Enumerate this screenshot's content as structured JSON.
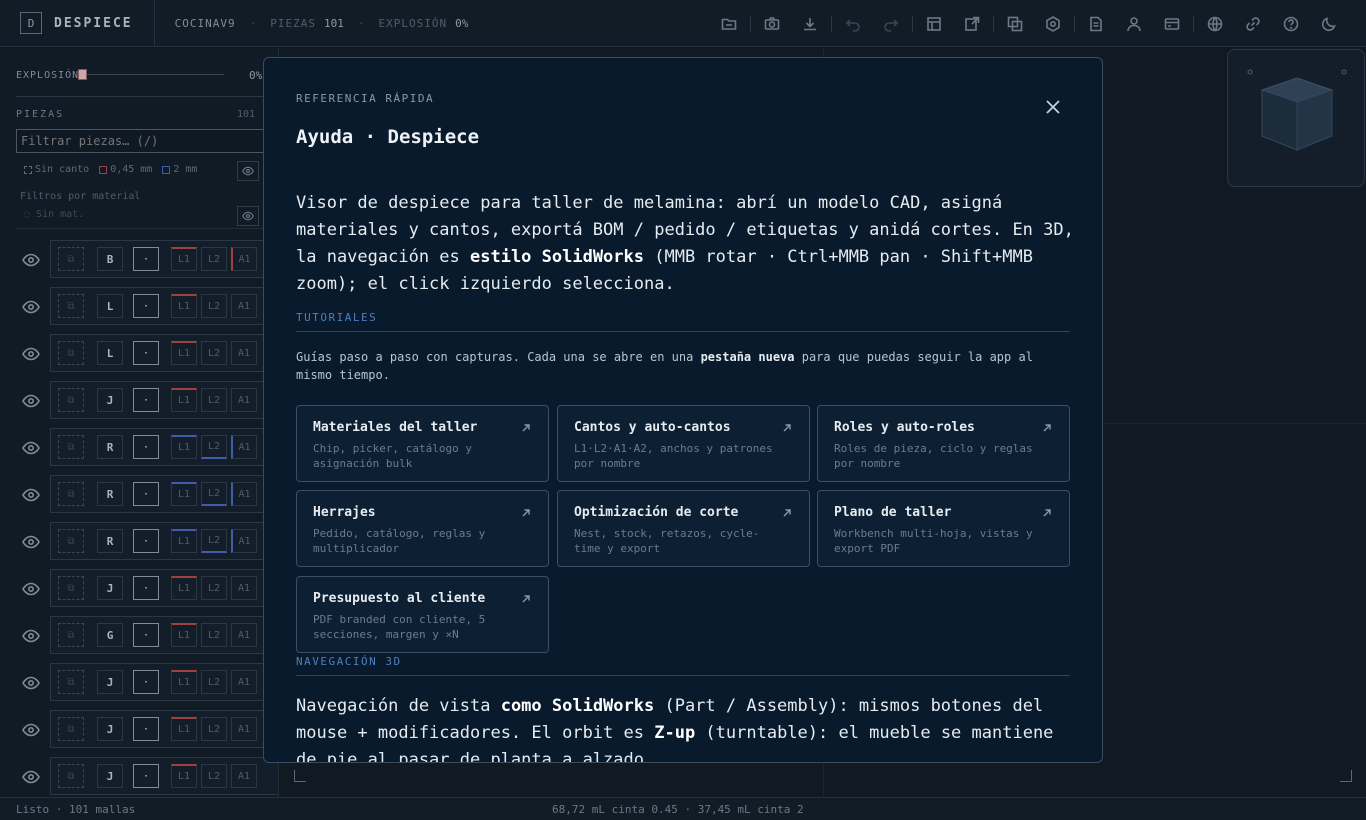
{
  "topbar": {
    "logo_letter": "D",
    "brand": "DESPIECE",
    "project": "COCINAV9",
    "sep": "·",
    "piezas_label": "PIEZAS",
    "piezas_value": "101",
    "explosion_label": "EXPLOSIÓN",
    "explosion_value": "0%",
    "icons": [
      "folder-open-icon",
      "camera-icon",
      "download-icon",
      "undo-icon",
      "redo-icon",
      "layout-icon",
      "edit-export-icon",
      "overlap-icon",
      "settings-hex-icon",
      "document-icon",
      "user-icon",
      "card-icon",
      "globe-icon",
      "link-icon",
      "help-icon",
      "moon-icon"
    ]
  },
  "sidebar": {
    "explosion_label": "EXPLOSIÓN",
    "explosion_value": "0%",
    "explosion_level": 0,
    "piezas_header": "PIEZAS",
    "piezas_count": "101",
    "filter_placeholder": "Filtrar piezas… (/)",
    "legend": {
      "sin_canto": "Sin canto",
      "c045": "0,45 mm",
      "c2": "2 mm"
    },
    "filters_title": "Filtros por material",
    "sin_mat": "Sin mat.",
    "rows": [
      {
        "mat": "B",
        "dot": "·",
        "l1": "L1",
        "l2": "L2",
        "a1": "A1"
      },
      {
        "mat": "L",
        "dot": "·",
        "l1": "L1",
        "l2": "L2",
        "a1": "A1"
      },
      {
        "mat": "L",
        "dot": "·",
        "l1": "L1",
        "l2": "L2",
        "a1": "A1"
      },
      {
        "mat": "J",
        "dot": "·",
        "l1": "L1",
        "l2": "L2",
        "a1": "A1"
      },
      {
        "mat": "R",
        "dot": "·",
        "l1": "L1",
        "l2": "L2",
        "a1": "A1"
      },
      {
        "mat": "R",
        "dot": "·",
        "l1": "L1",
        "l2": "L2",
        "a1": "A1"
      },
      {
        "mat": "R",
        "dot": "·",
        "l1": "L1",
        "l2": "L2",
        "a1": "A1"
      },
      {
        "mat": "J",
        "dot": "·",
        "l1": "L1",
        "l2": "L2",
        "a1": "A1"
      },
      {
        "mat": "G",
        "dot": "·",
        "l1": "L1",
        "l2": "L2",
        "a1": "A1"
      },
      {
        "mat": "J",
        "dot": "·",
        "l1": "L1",
        "l2": "L2",
        "a1": "A1"
      },
      {
        "mat": "J",
        "dot": "·",
        "l1": "L1",
        "l2": "L2",
        "a1": "A1"
      },
      {
        "mat": "J",
        "dot": "·",
        "l1": "L1",
        "l2": "L2",
        "a1": "A1"
      }
    ]
  },
  "status": {
    "left": "Listo · 101 mallas",
    "center": "68,72 mL cinta 0.45 · 37,45 mL cinta 2"
  },
  "modal": {
    "kicker": "REFERENCIA RÁPIDA",
    "title": "Ayuda · Despiece",
    "intro_1": "Visor de despiece para taller de melamina: abrí un modelo CAD, asigná materiales y cantos, exportá BOM / pedido / etiquetas y anidá cortes. En 3D, la navegación es ",
    "intro_bold": "estilo SolidWorks",
    "intro_2": " (MMB rotar · Ctrl+MMB pan · Shift+MMB zoom); el click izquierdo selecciona.",
    "tutoriales_h": "TUTORIALES",
    "tut_p1": "Guías paso a paso con capturas. Cada una se abre en una ",
    "tut_bold": "pestaña nueva",
    "tut_p2": " para que puedas seguir la app al mismo tiempo.",
    "cards": [
      {
        "title": "Materiales del taller",
        "desc": "Chip, picker, catálogo y asignación bulk"
      },
      {
        "title": "Cantos y auto-cantos",
        "desc": "L1·L2·A1·A2, anchos y patrones por nombre"
      },
      {
        "title": "Roles y auto-roles",
        "desc": "Roles de pieza, ciclo y reglas por nombre"
      },
      {
        "title": "Herrajes",
        "desc": "Pedido, catálogo, reglas y multiplicador"
      },
      {
        "title": "Optimización de corte",
        "desc": "Nest, stock, retazos, cycle-time y export"
      },
      {
        "title": "Plano de taller",
        "desc": "Workbench multi-hoja, vistas y export PDF"
      },
      {
        "title": "Presupuesto al cliente",
        "desc": "PDF branded con cliente, 5 secciones, margen y ×N"
      }
    ],
    "nav_h": "NAVEGACIÓN 3D",
    "nav_1": "Navegación de vista ",
    "nav_b1": "como SolidWorks",
    "nav_2": " (Part / Assembly): mismos botones del mouse + modificadores. El orbit es ",
    "nav_b2": "Z-up",
    "nav_3": " (turntable): el mueble se mantiene de pie al pasar de planta a alzado."
  },
  "colors": {
    "accent": "#4c7fbd",
    "canto_045": "#a04040",
    "canto_2": "#3e5fa8",
    "modal_bg": "#091a2d"
  }
}
